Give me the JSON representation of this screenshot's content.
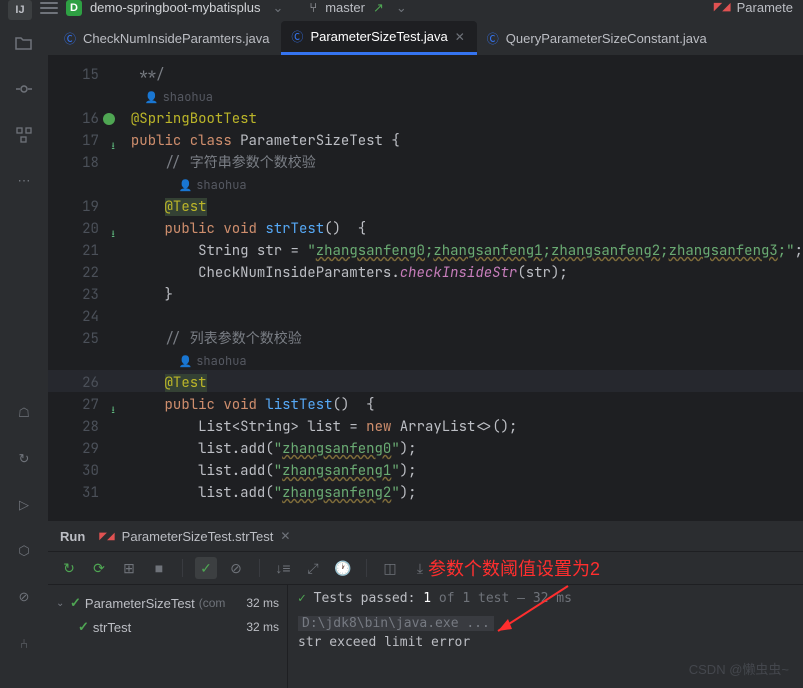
{
  "topbar": {
    "project_badge": "D",
    "project_name": "demo-springboot-mybatisplus",
    "branch": "master",
    "right_label": "Paramete"
  },
  "tabs": [
    {
      "label": "CheckNumInsideParamters.java",
      "active": false
    },
    {
      "label": "ParameterSizeTest.java",
      "active": true
    },
    {
      "label": "QueryParameterSizeConstant.java",
      "active": false
    }
  ],
  "code": {
    "author": "shaohua",
    "lines": [
      {
        "n": 15,
        "html": "&nbsp;<span class='comment'>**/</span>"
      },
      {
        "n": null,
        "html": "",
        "author_hint": true
      },
      {
        "n": 16,
        "html": "<span class='kw-annotation'>@SpringBootTest</span>",
        "mark": "green"
      },
      {
        "n": 17,
        "html": "<span class='kw'>public</span> <span class='kw'>class</span> <span class='type'>ParameterSizeTest</span> <span class='punct'>{</span>",
        "mark": "override"
      },
      {
        "n": 18,
        "html": "    <span class='comment'>// 字符串参数个数校验</span>"
      },
      {
        "n": null,
        "html": "",
        "author_hint": true,
        "indent": "    "
      },
      {
        "n": 19,
        "html": "    <span class='kw-annotation anno-hl'>@Test</span>"
      },
      {
        "n": 20,
        "html": "    <span class='kw'>public</span> <span class='kw'>void</span> <span class='method'>strTest</span><span class='punct'>()  {</span>",
        "mark": "override"
      },
      {
        "n": 21,
        "html": "        <span class='type'>String</span> <span class='type'>str</span> <span class='punct'>=</span> <span class='string'>\"</span><span class='string string-wavy'>zhangsanfeng0</span><span class='string'>;</span><span class='string string-wavy'>zhangsanfeng1</span><span class='string'>;</span><span class='string string-wavy'>zhangsanfeng2</span><span class='string'>;</span><span class='string string-wavy'>zhangsanfeng3</span><span class='string'>;\"</span><span class='punct'>;</span>"
      },
      {
        "n": 22,
        "html": "        <span class='type'>CheckNumInsideParamters</span><span class='punct'>.</span><span class='field'>checkInsideStr</span><span class='punct'>(</span><span class='type'>str</span><span class='punct'>);</span>"
      },
      {
        "n": 23,
        "html": "    <span class='punct'>}</span>"
      },
      {
        "n": 24,
        "html": ""
      },
      {
        "n": 25,
        "html": "    <span class='comment'>// 列表参数个数校验</span>"
      },
      {
        "n": null,
        "html": "",
        "author_hint": true,
        "indent": "    "
      },
      {
        "n": 26,
        "html": "    <span class='kw-annotation anno-hl'>@Test</span>"
      },
      {
        "n": 27,
        "html": "    <span class='kw'>public</span> <span class='kw'>void</span> <span class='method'>listTest</span><span class='punct'>()  {</span>",
        "mark": "override"
      },
      {
        "n": 28,
        "html": "        <span class='type'>List</span><span class='punct'>&lt;</span><span class='type'>String</span><span class='punct'>&gt;</span> <span class='type'>list</span> <span class='punct'>=</span> <span class='kw'>new</span> <span class='type'>ArrayList</span><span class='punct'>&lt;&gt;();</span>"
      },
      {
        "n": 29,
        "html": "        <span class='type'>list</span><span class='punct'>.add(</span><span class='string'>\"</span><span class='string string-wavy'>zhangsanfeng0</span><span class='string'>\"</span><span class='punct'>);</span>"
      },
      {
        "n": 30,
        "html": "        <span class='type'>list</span><span class='punct'>.add(</span><span class='string'>\"</span><span class='string string-wavy'>zhangsanfeng1</span><span class='string'>\"</span><span class='punct'>);</span>"
      },
      {
        "n": 31,
        "html": "        <span class='type'>list</span><span class='punct'>.add(</span><span class='string'>\"</span><span class='string string-wavy'>zhangsanfeng2</span><span class='string'>\"</span><span class='punct'>);</span>"
      }
    ]
  },
  "run": {
    "title": "Run",
    "config": "ParameterSizeTest.strTest",
    "tree": {
      "root": "ParameterSizeTest",
      "root_suffix": "(com",
      "root_time": "32 ms",
      "child": "strTest",
      "child_time": "32 ms"
    },
    "results": {
      "passed_label": "Tests passed:",
      "passed_count": "1",
      "of_label": "of 1 test",
      "dash_time": "– 32 ms"
    },
    "output": {
      "line1": "D:\\jdk8\\bin\\java.exe ...",
      "line2": "str exceed limit error"
    }
  },
  "annotation": "参数个数阈值设置为2",
  "watermark": "CSDN @懒虫虫~"
}
